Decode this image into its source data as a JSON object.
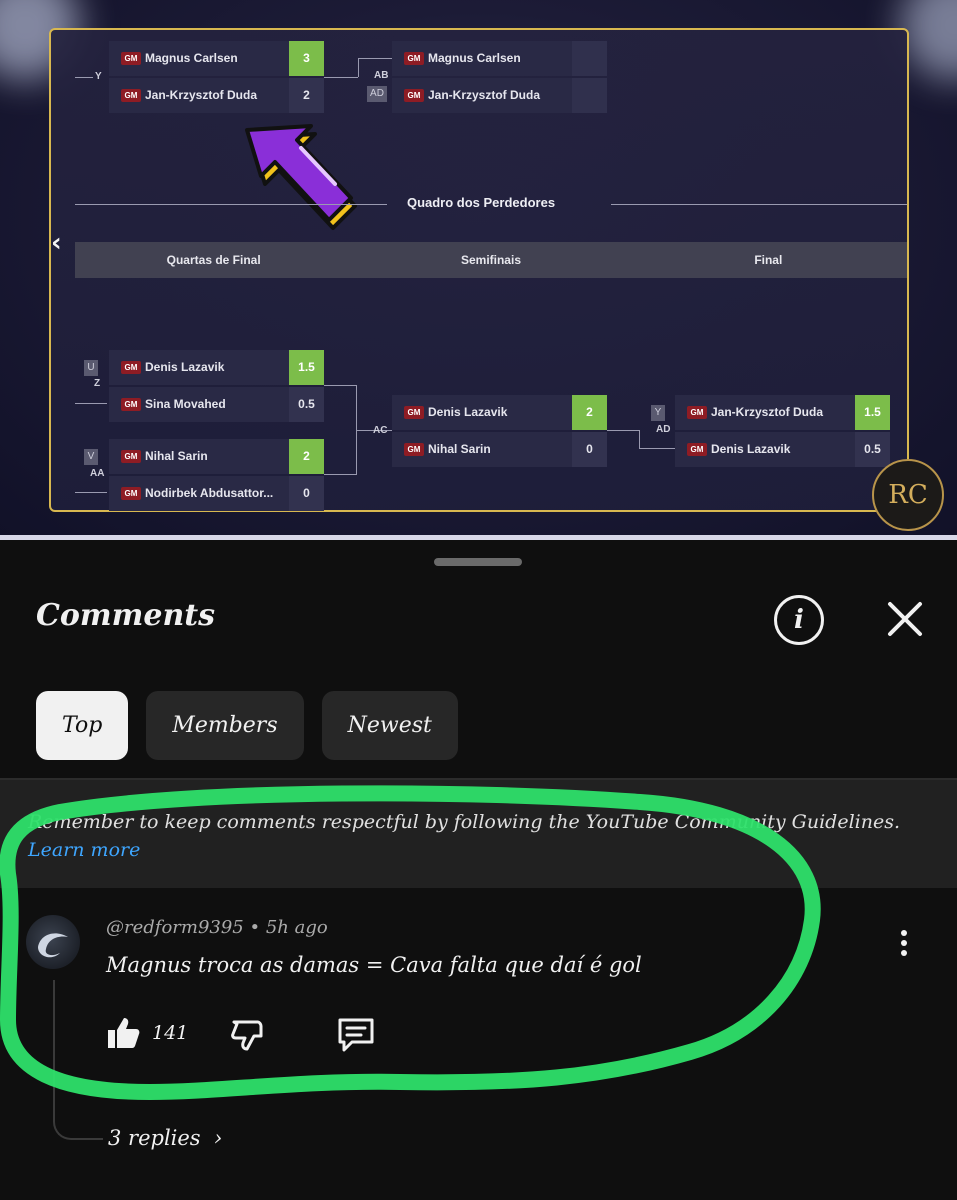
{
  "bracket": {
    "winners": [
      {
        "label": "Y",
        "players": [
          {
            "title": "GM",
            "name": "Magnus Carlsen",
            "score": "3",
            "win": true
          },
          {
            "title": "GM",
            "name": "Jan-Krzysztof Duda",
            "score": "2",
            "win": false
          }
        ]
      },
      {
        "label": "AB",
        "seed": "AD",
        "players": [
          {
            "title": "GM",
            "name": "Magnus Carlsen",
            "score": "",
            "win": false
          },
          {
            "title": "GM",
            "name": "Jan-Krzysztof Duda",
            "score": "",
            "win": false
          }
        ]
      }
    ],
    "section_title": "Quadro dos Perdedores",
    "rounds": [
      "Quartas de Final",
      "Semifinais",
      "Final"
    ],
    "losers": [
      {
        "label": "Z",
        "seed": "U",
        "players": [
          {
            "title": "GM",
            "name": "Denis Lazavik",
            "score": "1.5",
            "win": true
          },
          {
            "title": "GM",
            "name": "Sina Movahed",
            "score": "0.5",
            "win": false
          }
        ]
      },
      {
        "label": "AA",
        "seed": "V",
        "players": [
          {
            "title": "GM",
            "name": "Nihal Sarin",
            "score": "2",
            "win": true
          },
          {
            "title": "GM",
            "name": "Nodirbek Abdusattor...",
            "score": "0",
            "win": false
          }
        ]
      },
      {
        "label": "AC",
        "players": [
          {
            "title": "GM",
            "name": "Denis Lazavik",
            "score": "2",
            "win": true
          },
          {
            "title": "GM",
            "name": "Nihal Sarin",
            "score": "0",
            "win": false
          }
        ]
      },
      {
        "label": "AD",
        "seed": "Y",
        "players": [
          {
            "title": "GM",
            "name": "Jan-Krzysztof Duda",
            "score": "1.5",
            "win": true
          },
          {
            "title": "GM",
            "name": "Denis Lazavik",
            "score": "0.5",
            "win": false
          }
        ]
      }
    ],
    "channel_logo_text": "RC"
  },
  "comments_panel": {
    "title": "Comments",
    "tabs": [
      {
        "label": "Top",
        "active": true
      },
      {
        "label": "Members",
        "active": false
      },
      {
        "label": "Newest",
        "active": false
      }
    ],
    "guideline_text": "Remember to keep comments respectful by following the YouTube Community Guidelines.",
    "guideline_link": "Learn more",
    "comment": {
      "author": "@redform9395",
      "time": "5h ago",
      "separator": "•",
      "text": "Magnus troca as damas = Cava falta que daí é gol",
      "likes": "141",
      "replies": "3 replies"
    }
  },
  "colors": {
    "win_green": "#7cbd4a",
    "frame_gold": "#d8b850",
    "link_blue": "#3ea6ff",
    "annotation_green": "#2ee06a",
    "arrow_purple": "#8a2fd8",
    "arrow_yellow": "#f2c21c"
  },
  "icons": [
    "chevron-left-icon",
    "info-icon",
    "close-icon",
    "thumbs-up-icon",
    "thumbs-down-icon",
    "reply-icon",
    "more-vert-icon",
    "chevron-right-icon"
  ]
}
